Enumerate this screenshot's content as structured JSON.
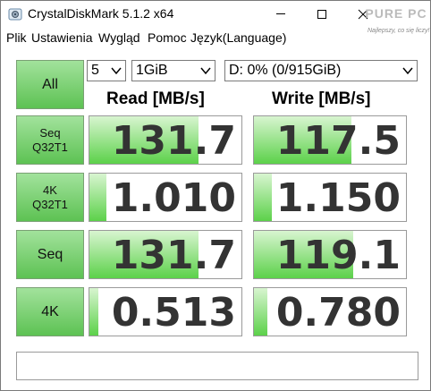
{
  "window": {
    "title": "CrystalDiskMark 5.1.2 x64",
    "watermark_label": "PURE PC",
    "watermark_text": "Najlepszy, co się liczy!"
  },
  "menu": [
    "Plik",
    "Ustawienia",
    "Wygląd",
    "Pomoc",
    "Język(Language)"
  ],
  "controls": {
    "all_label": "All",
    "count_value": "5",
    "size_value": "1GiB",
    "drive_value": "D: 0% (0/915GiB)"
  },
  "headers": {
    "read": "Read [MB/s]",
    "write": "Write [MB/s]"
  },
  "rows": [
    {
      "line1": "Seq",
      "line2": "Q32T1",
      "read": "131.7",
      "write": "117.5",
      "read_fill": 0.72,
      "write_fill": 0.64
    },
    {
      "line1": "4K",
      "line2": "Q32T1",
      "read": "1.010",
      "write": "1.150",
      "read_fill": 0.11,
      "write_fill": 0.12
    },
    {
      "line1": "Seq",
      "line2": "",
      "read": "131.7",
      "write": "119.1",
      "read_fill": 0.72,
      "write_fill": 0.65
    },
    {
      "line1": "4K",
      "line2": "",
      "read": "0.513",
      "write": "0.780",
      "read_fill": 0.06,
      "write_fill": 0.09
    }
  ],
  "comment": "",
  "colors": {
    "accent_green": "#5cd14a",
    "button_green": "#8cd884",
    "border": "#9a9a9a"
  }
}
